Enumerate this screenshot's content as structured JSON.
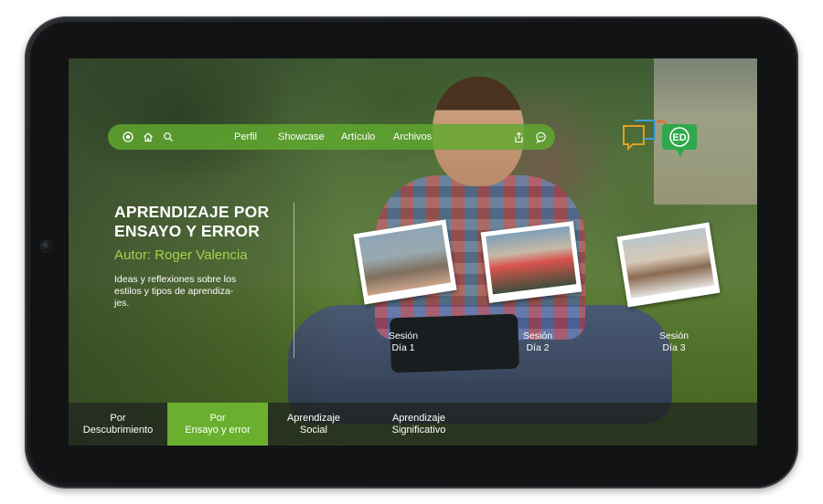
{
  "nav": {
    "icons": [
      "record-icon",
      "home-icon",
      "search-icon"
    ],
    "links": [
      "Perfil",
      "Showcase",
      "Artículo",
      "Archivos"
    ],
    "right_icons": [
      "share-icon",
      "chat-icon"
    ]
  },
  "logo": {
    "text": "ED",
    "colors": [
      "#e0a020",
      "#3aa0d8",
      "#2ea84a"
    ]
  },
  "article": {
    "title_line1": "APRENDIZAJE POR",
    "title_line2": "ENSAYO Y ERROR",
    "author": "Autor: Roger Valencia",
    "description": "Ideas y reflexiones sobre los estilos y tipos de aprendiza- jes."
  },
  "sessions": [
    {
      "line1": "Sesión",
      "line2": "Día 1"
    },
    {
      "line1": "Sesión",
      "line2": "Día 2"
    },
    {
      "line1": "Sesión",
      "line2": "Día 3"
    }
  ],
  "tabs": [
    {
      "line1": "Por",
      "line2": "Descubrimiento",
      "active": false
    },
    {
      "line1": "Por",
      "line2": "Ensayo y error",
      "active": true
    },
    {
      "line1": "Aprendizaje",
      "line2": "Social",
      "active": false
    },
    {
      "line1": "Aprendizaje",
      "line2": "Significativo",
      "active": false
    }
  ],
  "colors": {
    "accent": "#6ab02e",
    "author": "#a3d44b",
    "tab_active": "#6ab02e"
  }
}
